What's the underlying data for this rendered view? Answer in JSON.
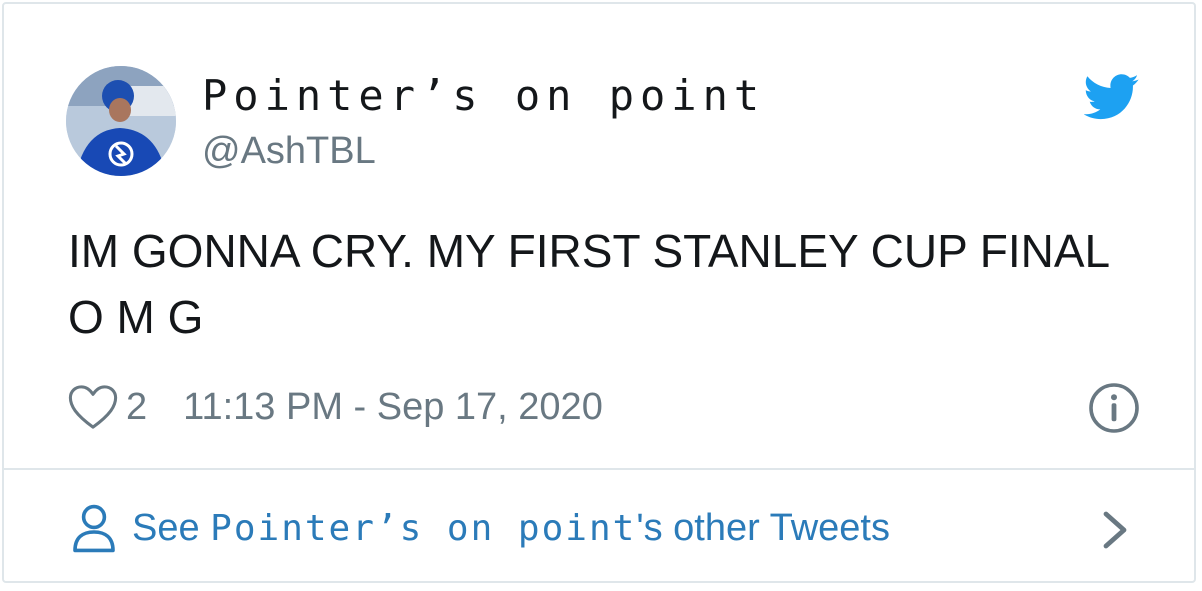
{
  "user": {
    "display_name": "Pointer’s on point",
    "handle": "@AshTBL"
  },
  "tweet": {
    "text": "IM GONNA CRY. MY FIRST STANLEY CUP FINAL O M G",
    "like_count": "2",
    "timestamp": "11:13 PM - Sep 17, 2020"
  },
  "footer": {
    "prefix": "See ",
    "name": "Pointer’s on point",
    "suffix": "'s other Tweets"
  },
  "icons": {
    "brand": "twitter-bird-icon",
    "like": "heart-icon",
    "info": "info-icon",
    "profile": "person-icon",
    "more": "chevron-right-icon"
  },
  "colors": {
    "brand": "#1da1f2",
    "link": "#2b7bb9",
    "text": "#14171a",
    "secondary": "#697882",
    "border": "#dfe6ea"
  }
}
